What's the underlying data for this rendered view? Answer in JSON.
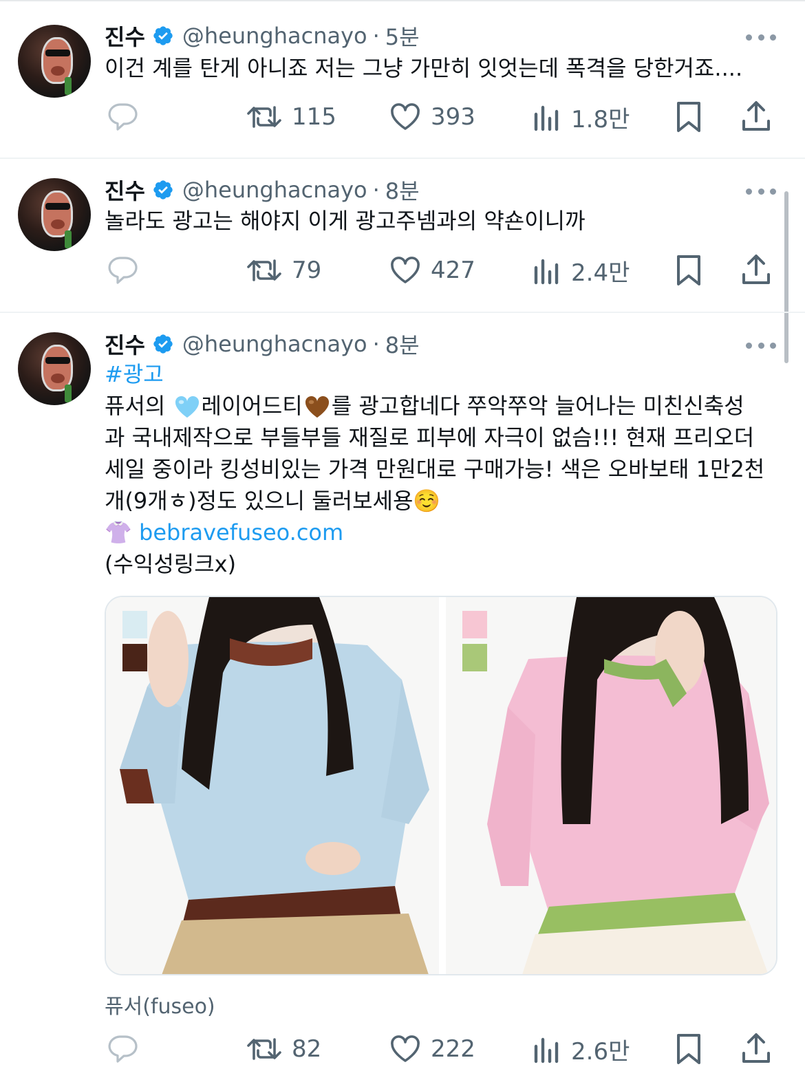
{
  "tweets": [
    {
      "name": "진수",
      "handle": "@heunghacnayo",
      "dot": "·",
      "time": "5분",
      "text_lines": [
        "이건 계를 탄게 아니죠 저는 그냥 가만히 잇엇는데 폭격을 당한거죠...."
      ],
      "retweets": "115",
      "likes": "393",
      "views": "1.8만"
    },
    {
      "name": "진수",
      "handle": "@heunghacnayo",
      "dot": "·",
      "time": "8분",
      "text_lines": [
        "놀라도 광고는 해야지 이게 광고주넴과의 약숀이니까"
      ],
      "retweets": "79",
      "likes": "427",
      "views": "2.4만"
    },
    {
      "name": "진수",
      "handle": "@heunghacnayo",
      "dot": "·",
      "time": "8분",
      "hashtag": "#광고",
      "line1_a": "퓨서의 ",
      "line1_b": "레이어드티",
      "line1_c": "를 광고합네다 쭈악쭈악 늘어나는 미친신축성",
      "line2": "과 국내제작으로 부들부들 재질로 피부에 자극이 없슴!!! 현재 프리오더",
      "line3": "세일 중이라 킹성비있는 가격 만원대로 구매가능! 색은 오바보태 1만2천",
      "line4": "개(9개ㅎ)정도 있으니 둘러보세용☺️",
      "link_emoji": "👚",
      "link": "bebravefuseo.com",
      "note": "(수익성링크x)",
      "source": "퓨서(fuseo)",
      "retweets": "82",
      "likes": "222",
      "views": "2.6만"
    }
  ],
  "colors": {
    "accent": "#1d9bf0",
    "muted": "#536471",
    "left_shirt": "#b9d5e6",
    "left_trim": "#5a2a1e",
    "right_shirt": "#f2b8cf",
    "right_trim": "#9dc16b",
    "swatch_light_blue": "#d9ecf2",
    "swatch_brown": "#4a2418",
    "swatch_pink": "#f7c6d3",
    "swatch_green": "#a9c878"
  },
  "icons": [
    "reply-icon",
    "retweet-icon",
    "like-icon",
    "views-icon",
    "bookmark-icon",
    "share-icon",
    "verified-badge-icon",
    "more-icon"
  ]
}
